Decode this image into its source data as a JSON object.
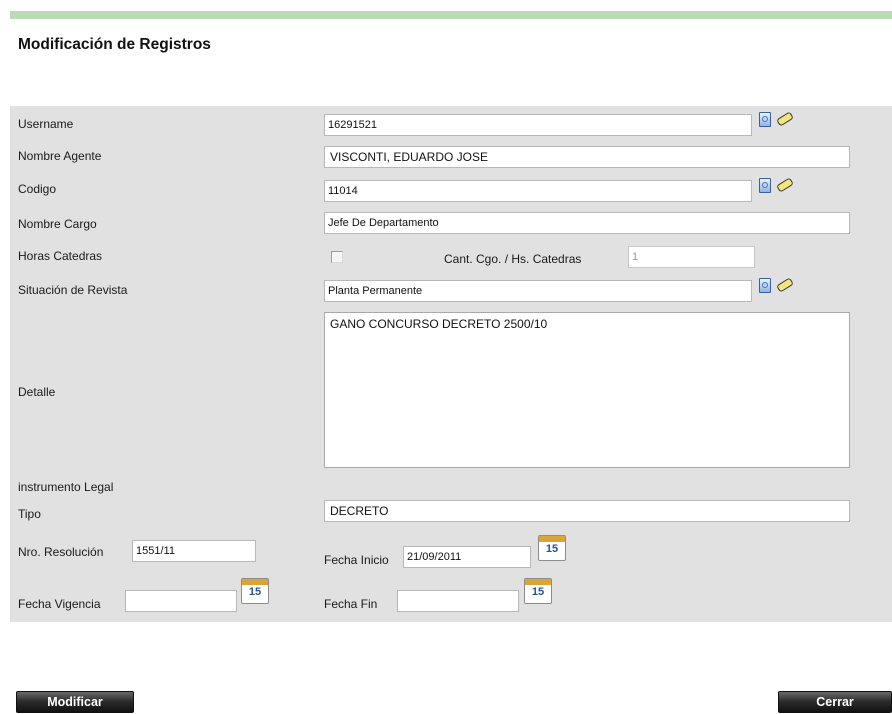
{
  "page": {
    "title": "Modificación de Registros"
  },
  "form": {
    "username": {
      "label": "Username",
      "value": "16291521"
    },
    "nombre_agente": {
      "label": "Nombre Agente",
      "value": "VISCONTI, EDUARDO JOSE"
    },
    "codigo": {
      "label": "Codigo",
      "value": "11014"
    },
    "nombre_cargo": {
      "label": "Nombre Cargo",
      "value": "Jefe De Departamento"
    },
    "horas_catedras": {
      "label": "Horas Catedras",
      "checked": false
    },
    "cant_cgo": {
      "label": "Cant. Cgo. / Hs. Catedras",
      "value": "1"
    },
    "situacion_revista": {
      "label": "Situación de Revista",
      "value": "Planta Permanente"
    },
    "detalle": {
      "label": "Detalle",
      "value": "GANO CONCURSO DECRETO 2500/10"
    },
    "instrumento_legal": {
      "label": "instrumento Legal"
    },
    "tipo": {
      "label": "Tipo",
      "value": "DECRETO"
    },
    "nro_resolucion": {
      "label": "Nro. Resolución",
      "value": "1551/11"
    },
    "fecha_inicio": {
      "label": "Fecha Inicio",
      "value": "21/09/2011"
    },
    "fecha_vigencia": {
      "label": "Fecha Vigencia",
      "value": ""
    },
    "fecha_fin": {
      "label": "Fecha Fin",
      "value": ""
    },
    "calendar_day": "15"
  },
  "buttons": {
    "modificar": "Modificar",
    "cerrar": "Cerrar"
  },
  "icons": {
    "lookup": "lookup-document-icon",
    "clear": "eraser-icon",
    "calendar": "calendar-icon"
  },
  "colors": {
    "accent_bar": "#b9dcb4",
    "panel": "#e1e1e1",
    "button": "#2d2d2d"
  }
}
